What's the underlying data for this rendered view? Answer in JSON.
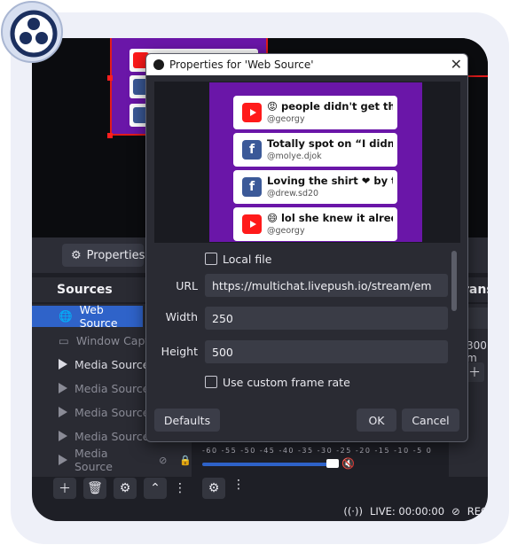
{
  "obs_window": {
    "preview_canvas": {},
    "properties_button": {
      "label": "Properties"
    },
    "sources": {
      "header": "Sources",
      "items": [
        {
          "label": "Web Source",
          "icon": "globe-icon",
          "active": true
        },
        {
          "label": "Window Captu",
          "icon": "window-icon",
          "dim": true
        },
        {
          "label": "Media Source",
          "icon": "play-icon"
        },
        {
          "label": "Media Source",
          "icon": "play-icon",
          "dim": true
        },
        {
          "label": "Media Source",
          "icon": "play-icon",
          "dim": true
        },
        {
          "label": "Media Source",
          "icon": "play-icon",
          "dim": true
        },
        {
          "label": "Media Source",
          "icon": "play-icon",
          "dim": true
        }
      ]
    },
    "mixer": {
      "db_scale": "-60 -55 -50 -45 -40 -35 -30 -25 -20 -15 -10 -5 0"
    },
    "transitions": {
      "header": "Transit",
      "duration": "300 m"
    },
    "status": {
      "live": "LIVE: 00:00:00",
      "rec": "REC"
    }
  },
  "dialog": {
    "title": "Properties for 'Web Source'",
    "chat_messages": [
      {
        "platform": "youtube",
        "text": "😡 people didn't get the la ..",
        "user": "@georgy"
      },
      {
        "platform": "facebook",
        "text": "Totally spot on “I didn’y li..",
        "user": "@molye.djok"
      },
      {
        "platform": "facebook",
        "text": "Loving the shirt ❤ by th ..",
        "user": "@drew.sd20"
      },
      {
        "platform": "youtube",
        "text": "😄 lol she knew it alredy",
        "user": "@georgy"
      }
    ],
    "local_file_label": "Local file",
    "url": {
      "label": "URL",
      "value": "https://multichat.livepush.io/stream/em"
    },
    "width": {
      "label": "Width",
      "value": "250"
    },
    "height": {
      "label": "Height",
      "value": "500"
    },
    "custom_fps_label": "Use custom frame rate",
    "buttons": {
      "defaults": "Defaults",
      "ok": "OK",
      "cancel": "Cancel"
    }
  },
  "colors": {
    "accent": "#2f63c9",
    "canvas_purple": "#6a16a8",
    "youtube": "#ff1a1a",
    "facebook": "#3b5998"
  }
}
